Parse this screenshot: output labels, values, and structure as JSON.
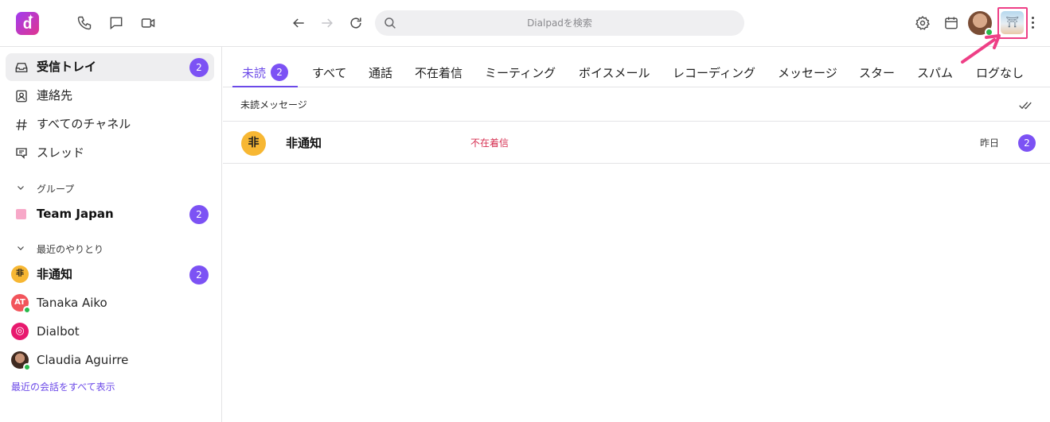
{
  "app": {
    "logo_letter": "d"
  },
  "search": {
    "placeholder": "Dialpadを検索"
  },
  "top_icons": [
    "phone-icon",
    "chat-icon",
    "video-icon",
    "back-arrow-icon",
    "forward-arrow-icon",
    "refresh-icon",
    "gear-icon",
    "calendar-icon",
    "kebab-icon"
  ],
  "sidebar": {
    "main_items": [
      {
        "label": "受信トレイ",
        "icon": "inbox-icon",
        "badge": "2",
        "active": true
      },
      {
        "label": "連絡先",
        "icon": "contacts-icon"
      },
      {
        "label": "すべてのチャネル",
        "icon": "hash-icon"
      },
      {
        "label": "スレッド",
        "icon": "threads-icon"
      }
    ],
    "groups_header": "グループ",
    "groups": [
      {
        "label": "Team Japan",
        "badge": "2",
        "color": "#f7a8c8"
      }
    ],
    "recent_header": "最近のやりとり",
    "recent": [
      {
        "label": "非通知",
        "avatar_text": "非",
        "avatar_color": "#f7b733",
        "badge": "2",
        "bold": true
      },
      {
        "label": "Tanaka Aiko",
        "avatar_text": "AT",
        "avatar_color": "#f2545b",
        "online": true
      },
      {
        "label": "Dialbot",
        "avatar_text": "◎",
        "avatar_color": "#e8196e"
      },
      {
        "label": "Claudia Aguirre",
        "avatar_text": "",
        "avatar_color": "#6b4a3a",
        "online": true
      }
    ],
    "show_all": "最近の会話をすべて表示"
  },
  "tabs": [
    {
      "label": "未読",
      "badge": "2",
      "active": true
    },
    {
      "label": "すべて"
    },
    {
      "label": "通話"
    },
    {
      "label": "不在着信"
    },
    {
      "label": "ミーティング"
    },
    {
      "label": "ボイスメール"
    },
    {
      "label": "レコーディング"
    },
    {
      "label": "メッセージ"
    },
    {
      "label": "スター"
    },
    {
      "label": "スパム"
    },
    {
      "label": "ログなし"
    }
  ],
  "list": {
    "header": "未読メッセージ",
    "rows": [
      {
        "avatar_text": "非",
        "name": "非通知",
        "status": "不在着信",
        "time": "昨日",
        "badge": "2"
      }
    ]
  },
  "colors": {
    "accent": "#7c52f4",
    "highlight": "#ee3f86",
    "missed_call": "#d62f51",
    "online": "#29b94c"
  }
}
